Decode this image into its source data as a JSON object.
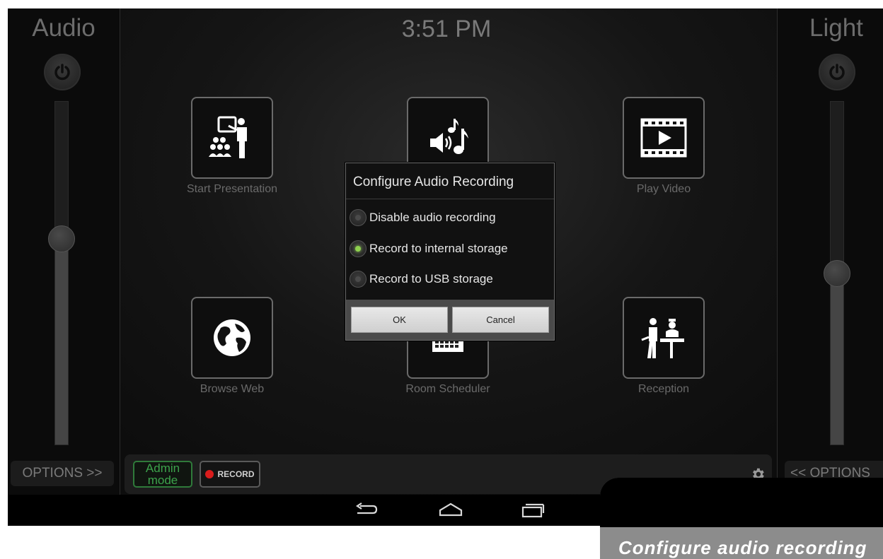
{
  "clock": "3:51 PM",
  "left_panel": {
    "title": "Audio",
    "slider_level": 0.6,
    "options_label": "OPTIONS >>",
    "power_icon": "power-icon"
  },
  "right_panel": {
    "title": "Light",
    "slider_level": 0.5,
    "options_label": "<< OPTIONS",
    "power_icon": "power-icon"
  },
  "tiles": [
    {
      "label": "Start Presentation",
      "icon": "presentation-icon"
    },
    {
      "label": "",
      "icon": "audio-music-icon"
    },
    {
      "label": "Play Video",
      "icon": "film-play-icon"
    },
    {
      "label": "Browse Web",
      "icon": "globe-icon"
    },
    {
      "label": "Room Scheduler",
      "icon": "calendar-icon"
    },
    {
      "label": "Reception",
      "icon": "reception-icon"
    }
  ],
  "bottom_bar": {
    "admin_label_1": "Admin",
    "admin_label_2": "mode",
    "record_label": "RECORD",
    "settings_icon": "gear-icon"
  },
  "dialog": {
    "title": "Configure Audio Recording",
    "options": [
      {
        "label": "Disable audio recording",
        "selected": false
      },
      {
        "label": "Record to internal storage",
        "selected": true
      },
      {
        "label": "Record to USB storage",
        "selected": false
      }
    ],
    "ok_label": "OK",
    "cancel_label": "Cancel"
  },
  "caption": "Configure audio recording",
  "colors": {
    "accent_green": "#8fd14f",
    "admin_green": "#3ca24b",
    "record_red": "#d91c1c"
  }
}
